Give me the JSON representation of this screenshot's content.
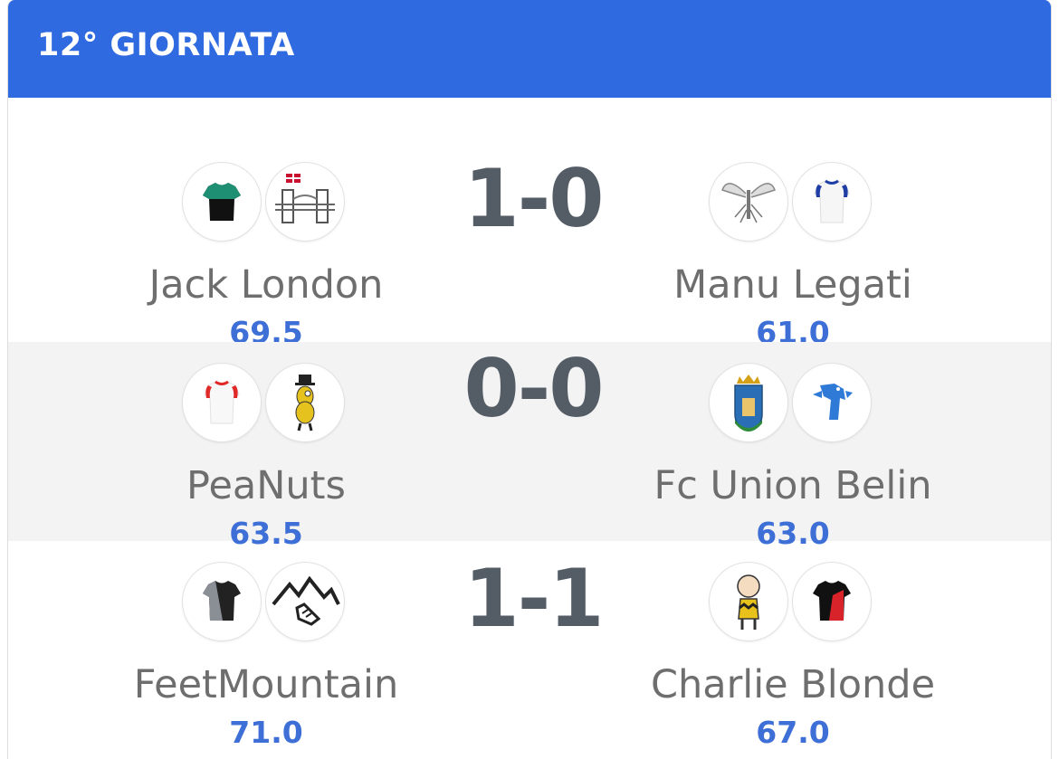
{
  "header": {
    "title": "12° GIORNATA"
  },
  "matches": [
    {
      "home": {
        "name": "Jack London",
        "points": "69.5",
        "badges": [
          "black-green-jersey-icon",
          "london-bridge-icon"
        ]
      },
      "result": "1-0",
      "away": {
        "name": "Manu Legati",
        "points": "61.0",
        "badges": [
          "mosquito-icon",
          "white-blue-jersey-icon"
        ]
      }
    },
    {
      "home": {
        "name": "PeaNuts",
        "points": "63.5",
        "badges": [
          "white-red-jersey-icon",
          "peanut-mascot-icon"
        ]
      },
      "result": "0-0",
      "away": {
        "name": "Fc Union Belin",
        "points": "63.0",
        "badges": [
          "city-crest-icon",
          "blue-bird-icon"
        ]
      }
    },
    {
      "home": {
        "name": "FeetMountain",
        "points": "71.0",
        "badges": [
          "grey-black-jersey-icon",
          "mountain-foot-icon"
        ]
      },
      "result": "1-1",
      "away": {
        "name": "Charlie Blonde",
        "points": "67.0",
        "badges": [
          "charlie-brown-icon",
          "black-red-jersey-icon"
        ]
      }
    }
  ],
  "colors": {
    "header_bg": "#2f6ae0",
    "points": "#3d6fd6",
    "result": "#545c66",
    "team_name": "#6e6e6e",
    "alt_row": "#f3f3f3"
  }
}
